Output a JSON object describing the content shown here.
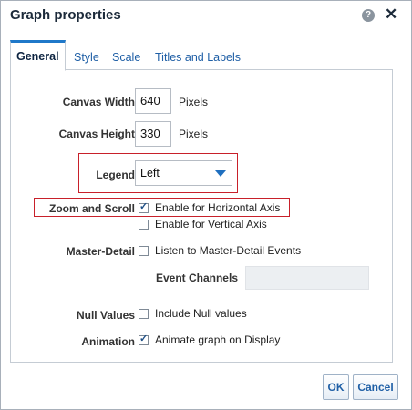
{
  "dialog": {
    "title": "Graph properties",
    "help_glyph": "?",
    "close_glyph": "✕"
  },
  "tabs": [
    {
      "label": "General",
      "active": true
    },
    {
      "label": "Style",
      "active": false
    },
    {
      "label": "Scale",
      "active": false
    },
    {
      "label": "Titles and Labels",
      "active": false
    }
  ],
  "general": {
    "canvas_width": {
      "label": "Canvas Width",
      "value": "640",
      "unit": "Pixels"
    },
    "canvas_height": {
      "label": "Canvas Height",
      "value": "330",
      "unit": "Pixels"
    },
    "legend": {
      "label": "Legend",
      "value": "Left"
    },
    "zoom": {
      "label": "Zoom and Scroll",
      "horizontal": {
        "text": "Enable for Horizontal Axis",
        "checked": true
      },
      "vertical": {
        "text": "Enable for Vertical Axis",
        "checked": false
      }
    },
    "master_detail": {
      "label": "Master-Detail",
      "text": "Listen to Master-Detail Events",
      "checked": false
    },
    "event_channels": {
      "label": "Event Channels",
      "value": ""
    },
    "null_values": {
      "label": "Null Values",
      "text": "Include Null values",
      "checked": false
    },
    "animation": {
      "label": "Animation",
      "text": "Animate graph on Display",
      "checked": true
    }
  },
  "buttons": {
    "ok": "OK",
    "cancel": "Cancel"
  },
  "colors": {
    "accent": "#1f78c9",
    "highlight": "#c8202a",
    "link": "#1f5fa6"
  }
}
